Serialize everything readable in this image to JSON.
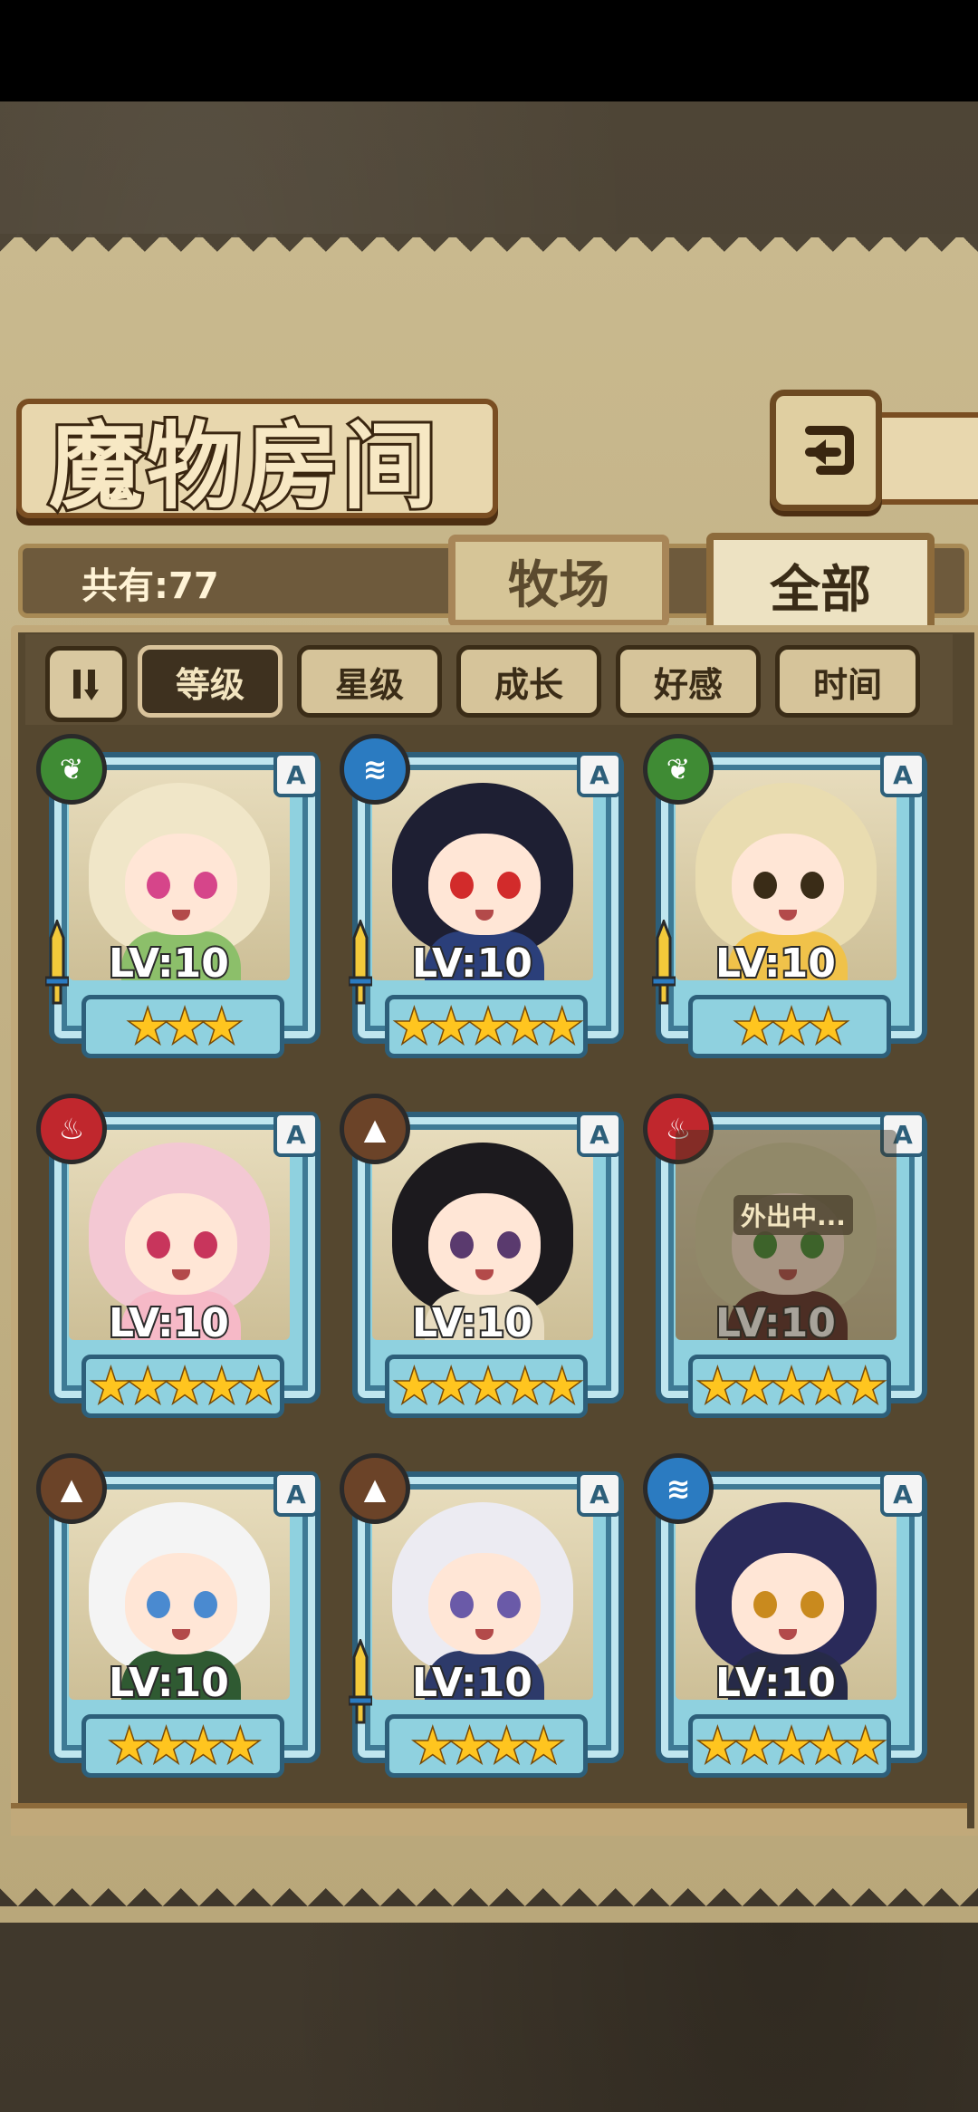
{
  "header": {
    "title": "魔物房间",
    "back_icon": "back-arrow-icon"
  },
  "info": {
    "count_label": "共有:77"
  },
  "tabs": [
    {
      "label": "牧场",
      "selected": false
    },
    {
      "label": "全部",
      "selected": true
    }
  ],
  "sort": {
    "toggle_icon": "sort-order-icon",
    "buttons": [
      {
        "label": "等级",
        "active": true
      },
      {
        "label": "星级",
        "active": false
      },
      {
        "label": "成长",
        "active": false
      },
      {
        "label": "好感",
        "active": false
      },
      {
        "label": "时间",
        "active": false
      }
    ]
  },
  "colors": {
    "nature": "#3f8b34",
    "water": "#2b7bc1",
    "fire": "#c0272d",
    "earth": "#6b4328",
    "star": "#ffc51f",
    "frame": "#8fd1df"
  },
  "monsters": [
    {
      "element": "nature",
      "element_icon": "leaf-icon",
      "rank": "A",
      "level": "LV:10",
      "stars": 3,
      "weapon": true,
      "away": "",
      "hair": "#f0e6c8",
      "eyes": "#d6458a",
      "body": "#8cbf6a"
    },
    {
      "element": "water",
      "element_icon": "water-waves-icon",
      "rank": "A",
      "level": "LV:10",
      "stars": 5,
      "weapon": true,
      "away": "",
      "hair": "#1e1f33",
      "eyes": "#d22b2b",
      "body": "#2b3f7a"
    },
    {
      "element": "nature",
      "element_icon": "leaf-icon",
      "rank": "A",
      "level": "LV:10",
      "stars": 3,
      "weapon": true,
      "away": "",
      "hair": "#e9dcb0",
      "eyes": "#3a2c17",
      "body": "#f0c24a"
    },
    {
      "element": "fire",
      "element_icon": "flame-icon",
      "rank": "A",
      "level": "LV:10",
      "stars": 5,
      "weapon": false,
      "away": "",
      "hair": "#f3c8d3",
      "eyes": "#c8355c",
      "body": "#f6b9c7"
    },
    {
      "element": "earth",
      "element_icon": "mountain-icon",
      "rank": "A",
      "level": "LV:10",
      "stars": 5,
      "weapon": false,
      "away": "",
      "hair": "#1c1a1e",
      "eyes": "#5a3a6e",
      "body": "#e8dcc0"
    },
    {
      "element": "fire",
      "element_icon": "flame-icon",
      "rank": "A",
      "level": "LV:10",
      "stars": 5,
      "weapon": false,
      "away": "外出中...",
      "hair": "#d8cfa6",
      "eyes": "#3f8b34",
      "body": "#5a2a28"
    },
    {
      "element": "earth",
      "element_icon": "mountain-icon",
      "rank": "A",
      "level": "LV:10",
      "stars": 4,
      "weapon": false,
      "away": "",
      "hair": "#f4f4f4",
      "eyes": "#4a8ad0",
      "body": "#2f5a32"
    },
    {
      "element": "earth",
      "element_icon": "mountain-icon",
      "rank": "A",
      "level": "LV:10",
      "stars": 4,
      "weapon": true,
      "away": "",
      "hair": "#ecebf2",
      "eyes": "#6a5aa8",
      "body": "#2d3a6a"
    },
    {
      "element": "water",
      "element_icon": "water-waves-icon",
      "rank": "A",
      "level": "LV:10",
      "stars": 5,
      "weapon": false,
      "away": "",
      "hair": "#2a2a5a",
      "eyes": "#c98a1e",
      "body": "#262a48"
    }
  ]
}
